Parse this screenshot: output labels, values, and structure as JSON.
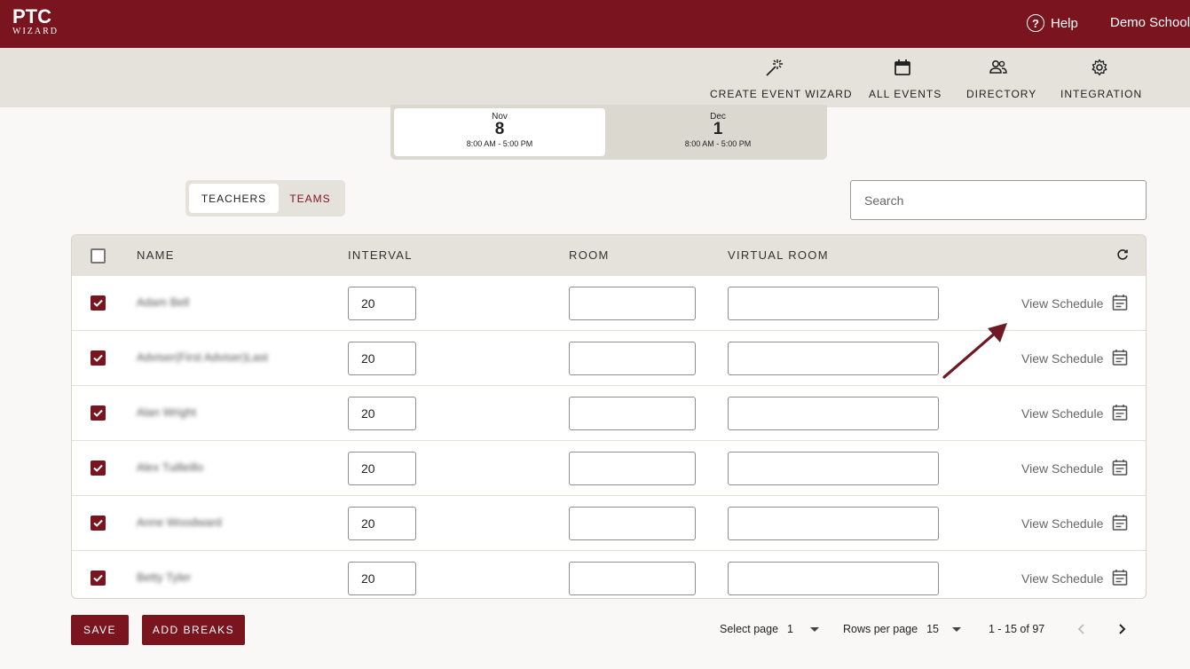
{
  "header": {
    "logo_line1": "PTC",
    "logo_line2": "WIZARD",
    "help_label": "Help",
    "school_name": "Demo School",
    "brand_color": "#7a1520"
  },
  "nav": {
    "items": [
      {
        "label": "CREATE EVENT WIZARD",
        "icon": "magic-wand-icon"
      },
      {
        "label": "ALL EVENTS",
        "icon": "calendar-icon"
      },
      {
        "label": "DIRECTORY",
        "icon": "people-icon"
      },
      {
        "label": "INTEGRATION",
        "icon": "gear-icon"
      }
    ]
  },
  "dates": [
    {
      "month": "Nov",
      "day": "8",
      "time": "8:00 AM - 5:00 PM",
      "selected": true
    },
    {
      "month": "Dec",
      "day": "1",
      "time": "8:00 AM - 5:00 PM",
      "selected": false
    }
  ],
  "toggle": {
    "teachers": "TEACHERS",
    "teams": "TEAMS",
    "selected": "TEACHERS"
  },
  "search": {
    "placeholder": "Search",
    "value": ""
  },
  "table": {
    "headers": {
      "name": "NAME",
      "interval": "INTERVAL",
      "room": "ROOM",
      "virtual_room": "VIRTUAL ROOM"
    },
    "rows": [
      {
        "name": "Adam Bell",
        "interval": "20",
        "room": "",
        "virtual_room": "",
        "checked": true,
        "action": "View Schedule"
      },
      {
        "name": "Adviser(First Adviser)Last",
        "interval": "20",
        "room": "",
        "virtual_room": "",
        "checked": true,
        "action": "View Schedule"
      },
      {
        "name": "Alan Wright",
        "interval": "20",
        "room": "",
        "virtual_room": "",
        "checked": true,
        "action": "View Schedule"
      },
      {
        "name": "Alex Tuilleillo",
        "interval": "20",
        "room": "",
        "virtual_room": "",
        "checked": true,
        "action": "View Schedule"
      },
      {
        "name": "Anne Woodward",
        "interval": "20",
        "room": "",
        "virtual_room": "",
        "checked": true,
        "action": "View Schedule"
      },
      {
        "name": "Betty Tyler",
        "interval": "20",
        "room": "",
        "virtual_room": "",
        "checked": true,
        "action": "View Schedule"
      }
    ]
  },
  "footer": {
    "save_label": "SAVE",
    "add_breaks_label": "ADD BREAKS",
    "select_page_label": "Select page",
    "select_page_value": "1",
    "rows_per_page_label": "Rows per page",
    "rows_per_page_value": "15",
    "range_text": "1 - 15 of 97"
  }
}
